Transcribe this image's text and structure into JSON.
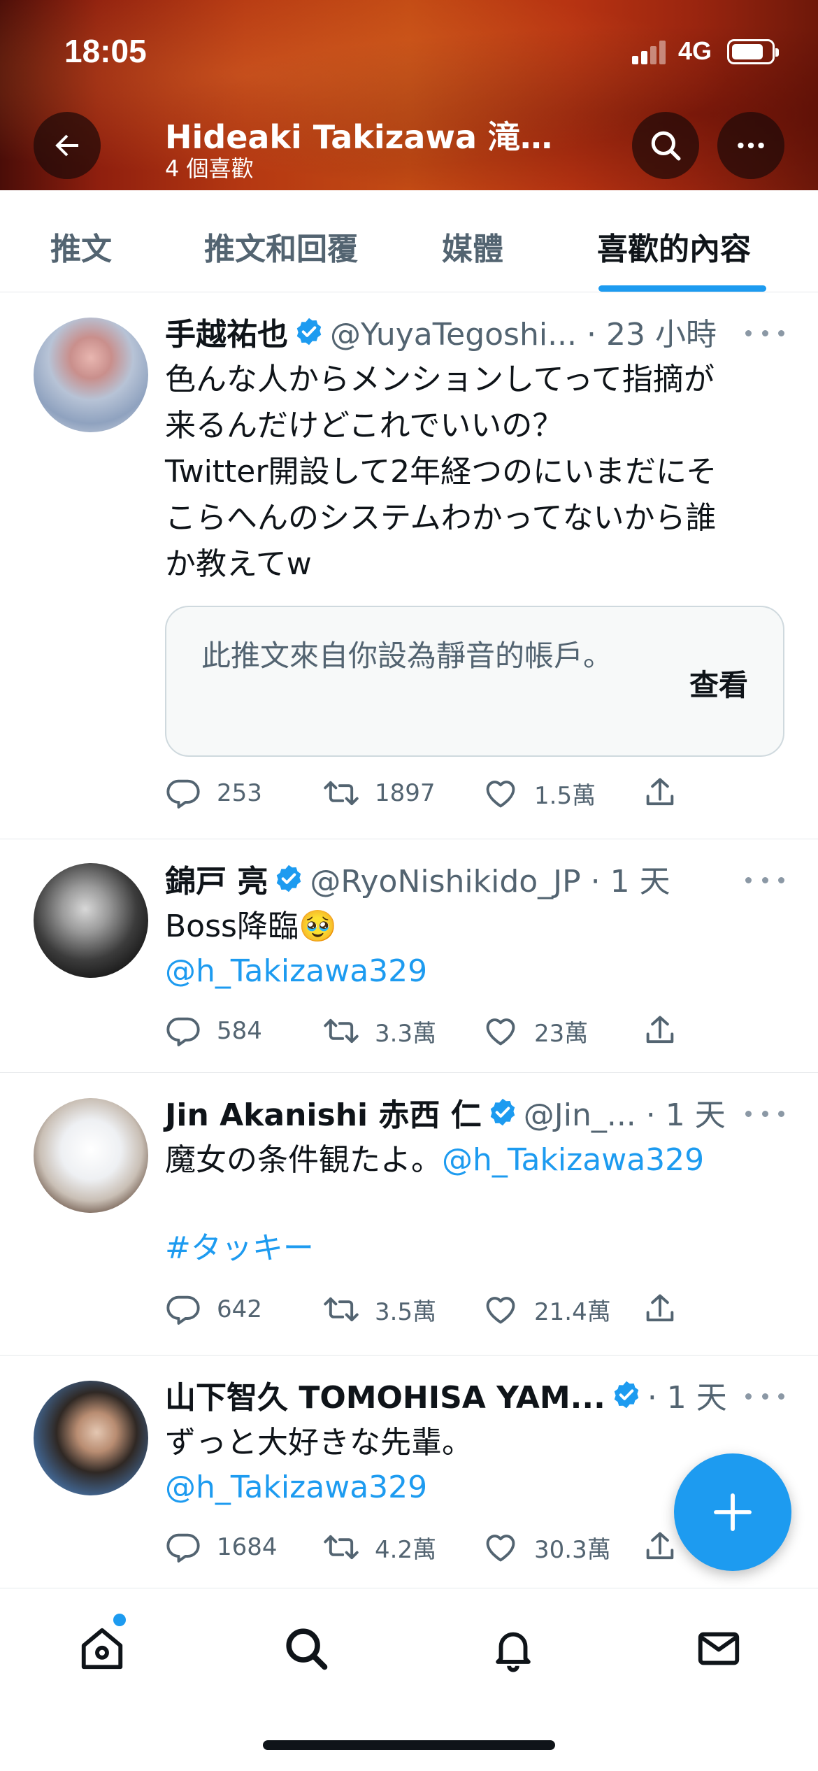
{
  "status": {
    "time": "18:05",
    "network": "4G"
  },
  "header": {
    "title": "Hideaki Takizawa 滝…",
    "subtitle": "4 個喜歡",
    "back_icon": "arrow-left-icon",
    "search_icon": "search-icon",
    "more_icon": "more-horizontal-icon",
    "banner_color": "#b53812"
  },
  "tabs": [
    {
      "label": "推文",
      "active": false
    },
    {
      "label": "推文和回覆",
      "active": false
    },
    {
      "label": "媒體",
      "active": false
    },
    {
      "label": "喜歡的內容",
      "active": true
    }
  ],
  "tweets": [
    {
      "name": "手越祐也",
      "handle": "@YuyaTegoshi... · 23 小時",
      "text": "色んな人からメンションしてって指摘が\n来るんだけどこれでいいの？\nTwitter開設して2年経つのにいまだにそ\nこらへんのシステムわかってないから誰\nか教えてw",
      "muted_notice": "此推文來自你設為靜音的帳戶。",
      "muted_action": "查看",
      "replies": "253",
      "retweets": "1897",
      "likes": "1.5萬"
    },
    {
      "name": "錦戸 亮",
      "handle": "@RyoNishikido_JP · 1 天",
      "text": "Boss降臨🥹",
      "mention": "@h_Takizawa329",
      "replies": "584",
      "retweets": "3.3萬",
      "likes": "23萬"
    },
    {
      "name": "Jin Akanishi  赤西 仁",
      "handle": "@Jin_... · 1 天",
      "text": "魔女の条件観たよ。",
      "mention": "@h_Takizawa329",
      "hashtag": "#タッキー",
      "replies": "642",
      "retweets": "3.5萬",
      "likes": "21.4萬"
    },
    {
      "name": "山下智久 TOMOHISA YAM...",
      "handle": " · 1 天",
      "text": "ずっと大好きな先輩。",
      "mention": "@h_Takizawa329",
      "replies": "1684",
      "retweets": "4.2萬",
      "likes": "30.3萬"
    }
  ],
  "fab": {
    "icon": "plus-icon"
  },
  "bottom_nav": [
    {
      "icon": "home-icon",
      "has_dot": true
    },
    {
      "icon": "search-icon"
    },
    {
      "icon": "bell-icon"
    },
    {
      "icon": "mail-icon"
    }
  ],
  "colors": {
    "accent": "#1d9bf0",
    "text": "#0f1419",
    "secondary": "#536471"
  }
}
